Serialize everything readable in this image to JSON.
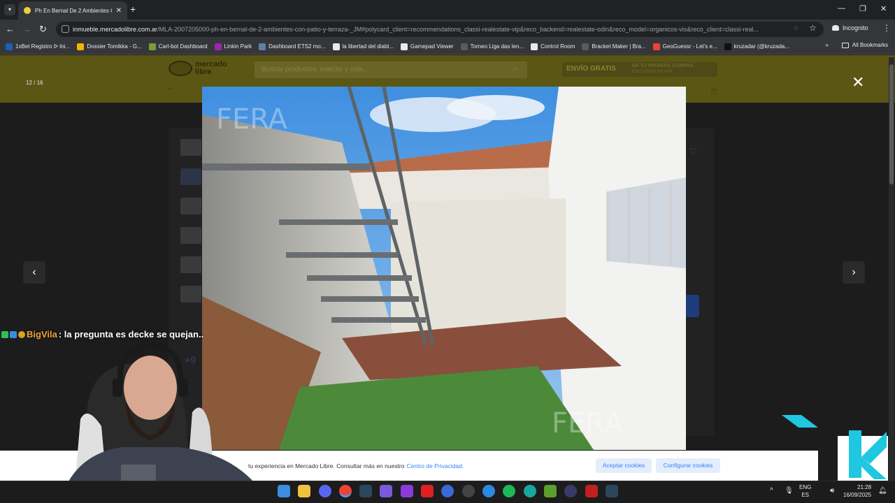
{
  "browser": {
    "tab_title": "Ph En Bernal De 2 Ambientes C",
    "url_domain": "inmueble.mercadolibre.com.ar",
    "url_path": "/MLA-2007205000-ph-en-bernal-de-2-ambientes-con-patio-y-terraza-_JM#polycard_client=recommendations_classi-realestate-vip&reco_backend=realestate-odin&reco_model=organicos-vis&reco_client=classi-real...",
    "incognito_label": "Incognito",
    "bookmarks": [
      {
        "label": "1xBet Registro ᐅ Ini...",
        "color": "#1f5fb0"
      },
      {
        "label": "Dossier Tomikka - G...",
        "color": "#f4b400"
      },
      {
        "label": "Carl-bot Dashboard",
        "color": "#7c9c3a"
      },
      {
        "label": "Linkin Park",
        "color": "#9c27b0"
      },
      {
        "label": "Dashboard ETS2 mo...",
        "color": "#5f7fa8"
      },
      {
        "label": "la libertad del diabl...",
        "color": "#e8eaed"
      },
      {
        "label": "Gamepad Viewer",
        "color": "#e8eaed"
      },
      {
        "label": "Torneo Liga das len...",
        "color": "#5a5a5a"
      },
      {
        "label": "Control Room",
        "color": "#e8eaed"
      },
      {
        "label": "Bracket Maker | Bra...",
        "color": "#5a5a5a"
      },
      {
        "label": "GeoGuessr - Let's e...",
        "color": "#ea4335"
      },
      {
        "label": "kruzadar (@kruzada...",
        "color": "#111111"
      }
    ],
    "all_bookmarks": "All Bookmarks"
  },
  "ml": {
    "logo_line1": "mercado",
    "logo_line2": "libre",
    "search_placeholder": "Buscar productos, marcas y más...",
    "envio_label": "ENVÍO GRATIS",
    "envio_sub": "EN TU PRIMERA COMPRA",
    "envio_sub2": "EXCLUSIVO EN APP",
    "more_photos": "+9"
  },
  "gallery": {
    "counter": "12 / 16",
    "watermark": "FERA"
  },
  "cookies": {
    "text": "tu experiencia en Mercado Libre. Consultar más en nuestro",
    "link": "Centro de Privacidad.",
    "accept": "Aceptar cookies",
    "configure": "Configurar cookies"
  },
  "chat": {
    "user": "BigVila",
    "message": ": la pregunta es decke se quejan.."
  },
  "taskbar": {
    "lang_line1": "ENG",
    "lang_line2": "ES",
    "time": "21:28",
    "date": "16/09/2025"
  }
}
